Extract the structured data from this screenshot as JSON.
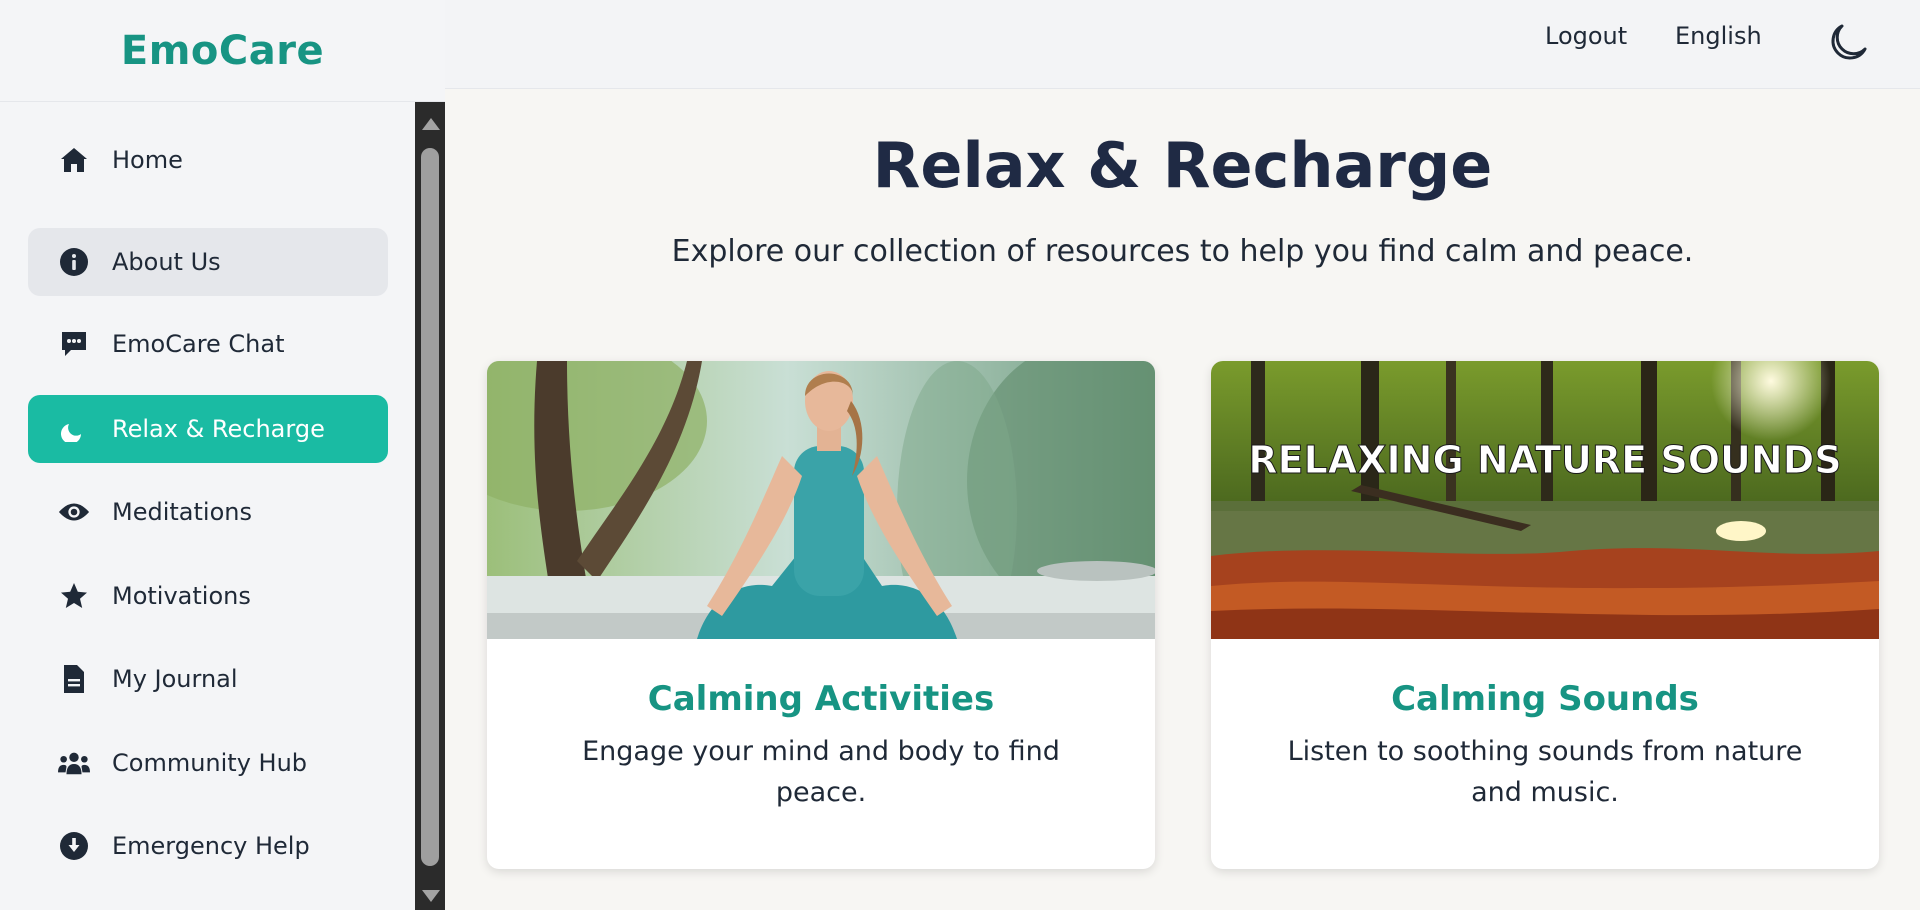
{
  "app": {
    "logo": "EmoCare"
  },
  "topbar": {
    "logout": "Logout",
    "language": "English",
    "theme_icon": "moon-icon"
  },
  "sidebar": {
    "items": [
      {
        "label": "Home",
        "icon": "home-icon"
      },
      {
        "label": "About Us",
        "icon": "info-icon",
        "state": "hover"
      },
      {
        "label": "EmoCare Chat",
        "icon": "chat-icon"
      },
      {
        "label": "Relax & Recharge",
        "icon": "moon-small-icon",
        "state": "active"
      },
      {
        "label": "Meditations",
        "icon": "eye-icon"
      },
      {
        "label": "Motivations",
        "icon": "star-icon"
      },
      {
        "label": "My Journal",
        "icon": "journal-icon"
      },
      {
        "label": "Community Hub",
        "icon": "users-icon"
      },
      {
        "label": "Emergency Help",
        "icon": "arrow-down-circle-icon"
      }
    ]
  },
  "main": {
    "title": "Relax & Recharge",
    "subtitle": "Explore our collection of resources to help you find calm and peace.",
    "cards": [
      {
        "title": "Calming Activities",
        "description": "Engage your mind and body to find peace.",
        "image": "woman-meditating-in-forest"
      },
      {
        "title": "Calming Sounds",
        "description": "Listen to soothing sounds from nature and music.",
        "image": "forest-stream-nature-sounds",
        "image_text": "RELAXING NATURE SOUNDS"
      }
    ]
  },
  "colors": {
    "brand": "#179483",
    "active_nav": "#1abba3",
    "title": "#1f2a44"
  }
}
